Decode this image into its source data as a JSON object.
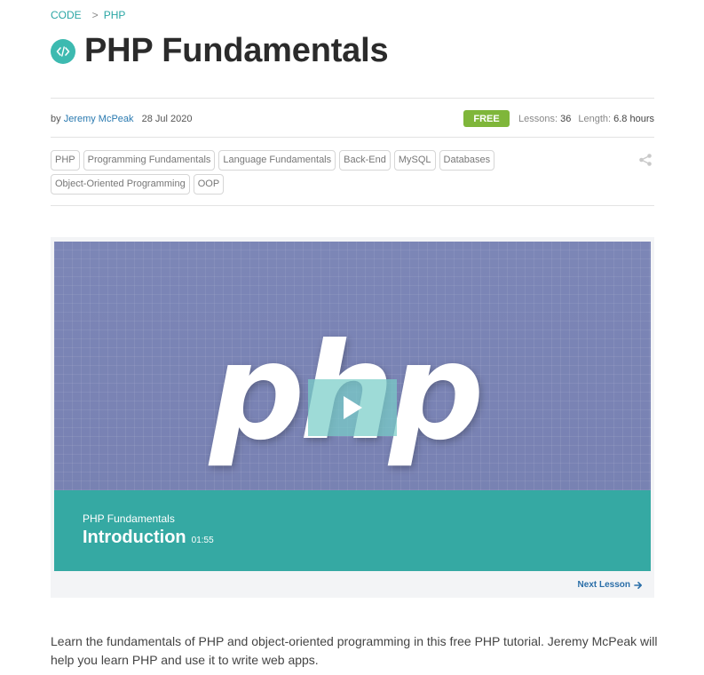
{
  "breadcrumb": {
    "category": "CODE",
    "separator": ">",
    "subcategory": "PHP"
  },
  "title": "PHP Fundamentals",
  "meta": {
    "by": "by",
    "author": "Jeremy McPeak",
    "date": "28 Jul 2020",
    "badge": "FREE",
    "lessons_label": "Lessons:",
    "lessons_value": "36",
    "length_label": "Length:",
    "length_value": "6.8 hours"
  },
  "tags": [
    "PHP",
    "Programming Fundamentals",
    "Language Fundamentals",
    "Back-End",
    "MySQL",
    "Databases",
    "Object-Oriented Programming",
    "OOP"
  ],
  "video": {
    "thumbnail_logo_text": "php",
    "course_name": "PHP Fundamentals",
    "lesson_title": "Introduction",
    "lesson_duration": "01:55",
    "next_label": "Next Lesson"
  },
  "description": "Learn the fundamentals of PHP and object-oriented programming in this free PHP tutorial. Jeremy McPeak will help you learn PHP and use it to write web apps.",
  "colors": {
    "accent": "#35a9a3",
    "badge": "#7fb63a",
    "link": "#2a7ab0",
    "thumb": "#7a84b4"
  },
  "icons": {
    "category": "code-icon",
    "share": "share-icon",
    "play": "play-icon",
    "next": "arrow-right-icon"
  }
}
